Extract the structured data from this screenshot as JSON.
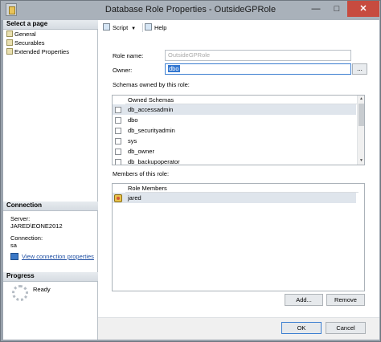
{
  "window": {
    "title": "Database Role Properties - OutsideGPRole",
    "min": "—",
    "max": "□",
    "close": "✕"
  },
  "left_panel": {
    "select_page": {
      "heading": "Select a page",
      "items": [
        {
          "label": "General"
        },
        {
          "label": "Securables"
        },
        {
          "label": "Extended Properties"
        }
      ]
    },
    "connection": {
      "heading": "Connection",
      "server_label": "Server:",
      "server_value": "JARED\\EONE2012",
      "connection_label": "Connection:",
      "connection_value": "sa",
      "view_link": "View connection properties"
    },
    "progress": {
      "heading": "Progress",
      "status": "Ready"
    }
  },
  "toolbar": {
    "script_label": "Script",
    "help_label": "Help"
  },
  "form": {
    "role_name_label": "Role name:",
    "role_name_value": "OutsideGPRole",
    "owner_label": "Owner:",
    "owner_value": "dbo",
    "browse_label": "...",
    "schemas_label": "Schemas owned by this role:",
    "schemas_header": "Owned Schemas",
    "schemas": [
      {
        "name": "db_accessadmin",
        "checked": false
      },
      {
        "name": "dbo",
        "checked": false
      },
      {
        "name": "db_securityadmin",
        "checked": false
      },
      {
        "name": "sys",
        "checked": false
      },
      {
        "name": "db_owner",
        "checked": false
      },
      {
        "name": "db_backupoperator",
        "checked": false
      }
    ],
    "members_label": "Members of this role:",
    "members_header": "Role Members",
    "members": [
      {
        "name": "jared"
      }
    ],
    "add_label": "Add...",
    "remove_label": "Remove"
  },
  "footer": {
    "ok_label": "OK",
    "cancel_label": "Cancel"
  },
  "colors": {
    "accent": "#3478d1",
    "close": "#c74b3f",
    "link": "#1f4fa3"
  }
}
